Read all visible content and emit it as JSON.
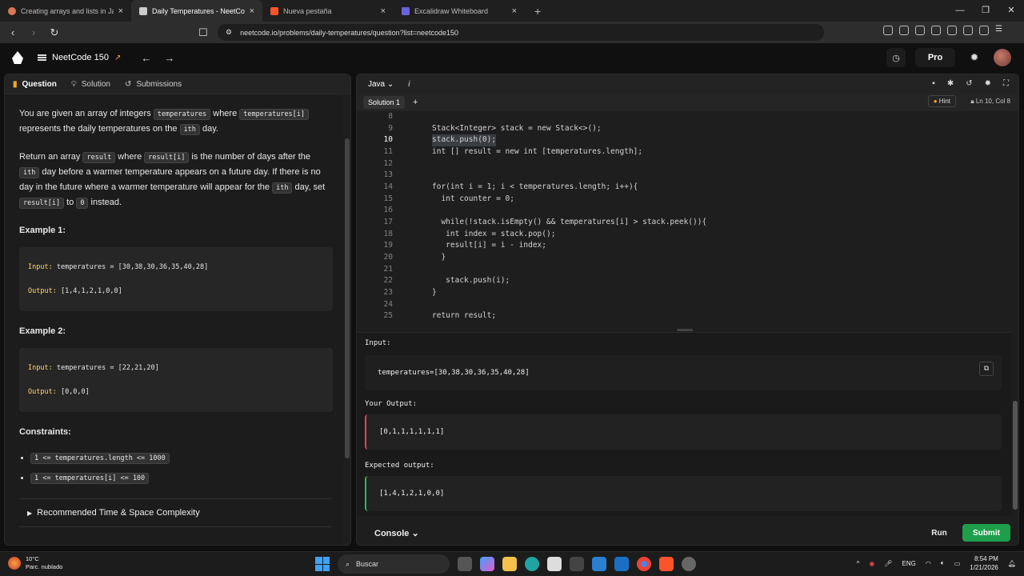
{
  "browser": {
    "tabs": [
      {
        "label": "Creating arrays and lists in Java - Cla",
        "active": false,
        "color": "#d97757"
      },
      {
        "label": "Daily Temperatures - NeetCode",
        "active": true,
        "color": "#cccccc"
      },
      {
        "label": "Nueva pestaña",
        "active": false,
        "color": "#fb542b"
      },
      {
        "label": "Excalidraw Whiteboard",
        "active": false,
        "color": "#6965db"
      }
    ],
    "url": "neetcode.io/problems/daily-temperatures/question?list=neetcode150"
  },
  "appbar": {
    "title": "NeetCode 150",
    "pro_label": "Pro"
  },
  "left": {
    "tabs": [
      "Question",
      "Solution",
      "Submissions"
    ],
    "para1": {
      "t1": "You are given an array of integers ",
      "c1": "temperatures",
      "t2": " where ",
      "c2": "temperatures[i]",
      "t3": " represents the daily temperatures on the ",
      "c3": "ith",
      "t4": " day."
    },
    "para2": {
      "t1": "Return an array ",
      "c1": "result",
      "t2": " where ",
      "c2": "result[i]",
      "t3": " is the number of days after the ",
      "c3": "ith",
      "t4": " day before a warmer temperature appears on a future day. If there is no day in the future where a warmer temperature will appear for the ",
      "c4": "ith",
      "t5": " day, set ",
      "c5": "result[i]",
      "t6": " to ",
      "c6": "0",
      "t7": " instead."
    },
    "example1": {
      "title": "Example 1:",
      "input_key": "Input:",
      "input_val": " temperatures = [30,38,30,36,35,40,28]",
      "output_key": "Output:",
      "output_val": " [1,4,1,2,1,0,0]"
    },
    "example2": {
      "title": "Example 2:",
      "input_key": "Input:",
      "input_val": " temperatures = [22,21,20]",
      "output_key": "Output:",
      "output_val": " [0,0,0]"
    },
    "constraints_title": "Constraints:",
    "constraints": [
      "1 <= temperatures.length <= 1000",
      "1 <= temperatures[i] <= 100"
    ],
    "recommended": "Recommended Time & Space Complexity"
  },
  "editor": {
    "language": "Java",
    "info_icon": "i",
    "solution_tab": "Solution 1",
    "hint": "Hint",
    "cursor_pos": "Ln 10, Col 8",
    "lines": [
      {
        "n": "8",
        "code": ""
      },
      {
        "n": "9",
        "code": "Stack<Integer> stack = new Stack<>();"
      },
      {
        "n": "10",
        "code": "stack.push(0);"
      },
      {
        "n": "11",
        "code": "int [] result = new int [temperatures.length];"
      },
      {
        "n": "12",
        "code": ""
      },
      {
        "n": "13",
        "code": ""
      },
      {
        "n": "14",
        "code": "for(int i = 1; i < temperatures.length; i++){"
      },
      {
        "n": "15",
        "code": "  int counter = 0;"
      },
      {
        "n": "16",
        "code": ""
      },
      {
        "n": "17",
        "code": "  while(!stack.isEmpty() && temperatures[i] > stack.peek()){"
      },
      {
        "n": "18",
        "code": "   int index = stack.pop();"
      },
      {
        "n": "19",
        "code": "   result[i] = i - index;"
      },
      {
        "n": "20",
        "code": "  }"
      },
      {
        "n": "21",
        "code": ""
      },
      {
        "n": "22",
        "code": "   stack.push(i);"
      },
      {
        "n": "23",
        "code": "}"
      },
      {
        "n": "24",
        "code": ""
      },
      {
        "n": "25",
        "code": "return result;"
      }
    ]
  },
  "results": {
    "input_label": "Input:",
    "input_value": "temperatures=[30,38,30,36,35,40,28]",
    "your_output_label": "Your Output:",
    "your_output_value": "[0,1,1,1,1,1,1]",
    "expected_label": "Expected output:",
    "expected_value": "[1,4,1,2,1,0,0]"
  },
  "footer": {
    "console": "Console",
    "run": "Run",
    "submit": "Submit"
  },
  "taskbar": {
    "temp": "10°C",
    "weather": "Parc. nublado",
    "search": "Buscar",
    "lang": "ENG",
    "time": "8:54 PM",
    "date": "1/21/2026"
  }
}
